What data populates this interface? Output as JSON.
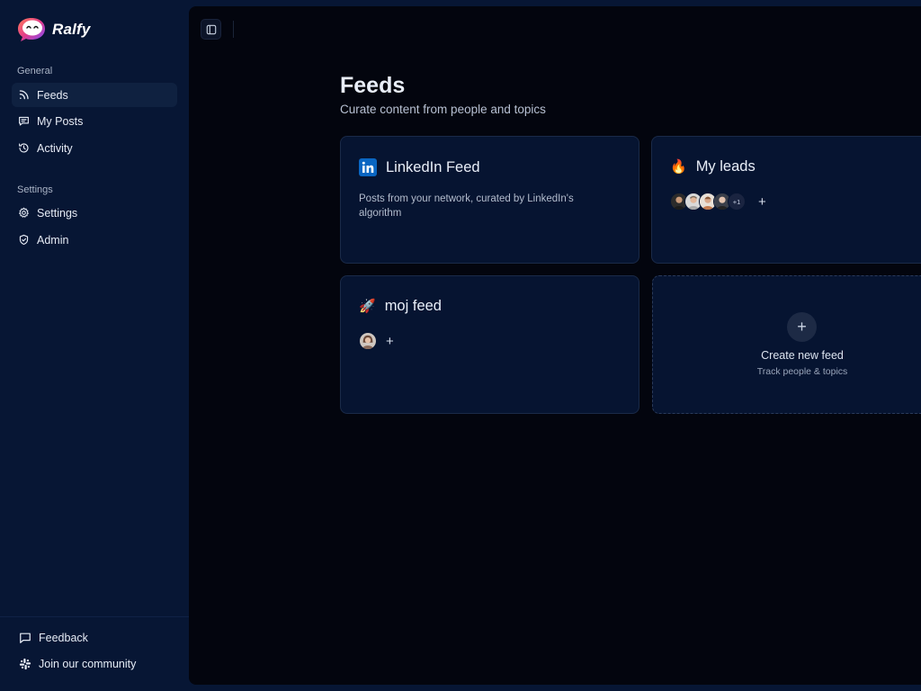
{
  "app": {
    "name": "Ralfy"
  },
  "sidebar": {
    "general_label": "General",
    "general_items": [
      {
        "label": "Feeds",
        "icon": "rss-icon",
        "active": true
      },
      {
        "label": "My Posts",
        "icon": "message-square-icon",
        "active": false
      },
      {
        "label": "Activity",
        "icon": "history-icon",
        "active": false
      }
    ],
    "settings_label": "Settings",
    "settings_items": [
      {
        "label": "Settings",
        "icon": "gear-icon"
      },
      {
        "label": "Admin",
        "icon": "shield-icon"
      }
    ],
    "footer_items": [
      {
        "label": "Feedback",
        "icon": "message-icon"
      },
      {
        "label": "Join our community",
        "icon": "slack-icon"
      }
    ]
  },
  "main": {
    "title": "Feeds",
    "subtitle": "Curate content from people and topics",
    "feeds": [
      {
        "title": "LinkedIn Feed",
        "icon": "linkedin-icon",
        "description": "Posts from your network, curated by LinkedIn's algorithm"
      },
      {
        "title": "My leads",
        "icon": "🔥",
        "extra_count": "+1"
      },
      {
        "title": "moj feed",
        "icon": "🚀"
      }
    ],
    "create": {
      "title": "Create new feed",
      "subtitle": "Track people & topics",
      "plus": "+"
    },
    "add_label": "+"
  },
  "colors": {
    "sidebar_bg": "#071634",
    "main_bg": "#03050e",
    "card_bg": "#061431",
    "linkedin": "#0a66c2"
  }
}
